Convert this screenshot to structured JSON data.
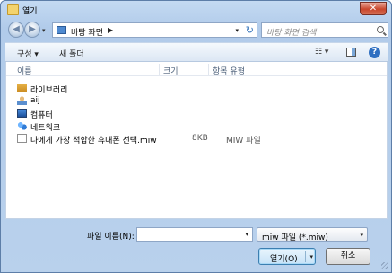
{
  "window": {
    "title": "열기",
    "close_symbol": "✕"
  },
  "nav": {
    "back_symbol": "◀",
    "forward_symbol": "▶",
    "dropdown_symbol": "▾",
    "address": "바탕 화면",
    "address_arrow": "▶",
    "refresh_symbol": "↻",
    "search_placeholder": "바탕 화면 검색"
  },
  "toolbar": {
    "organize": "구성 ▾",
    "new_folder": "새 폴더",
    "view_symbol": "☷ ▾",
    "help": "?"
  },
  "columns": {
    "name": "이름",
    "size": "크기",
    "type": "항목 유형"
  },
  "files": [
    {
      "name": "라이브러리",
      "size": "",
      "type": "",
      "icon": "library-icon"
    },
    {
      "name": "aij",
      "size": "",
      "type": "",
      "icon": "user-folder-icon"
    },
    {
      "name": "컴퓨터",
      "size": "",
      "type": "",
      "icon": "computer-icon"
    },
    {
      "name": "네트워크",
      "size": "",
      "type": "",
      "icon": "network-icon"
    },
    {
      "name": "나에게 가장 적합한 휴대폰 선택.miw",
      "size": "8KB",
      "type": "MIW 파일",
      "icon": "document-icon"
    }
  ],
  "footer": {
    "filename_label": "파일 이름(N):",
    "filename_value": "",
    "filter": "miw 파일 (*.miw)",
    "open": "열기(O)",
    "cancel": "취소",
    "dropdown_symbol": "▾"
  }
}
